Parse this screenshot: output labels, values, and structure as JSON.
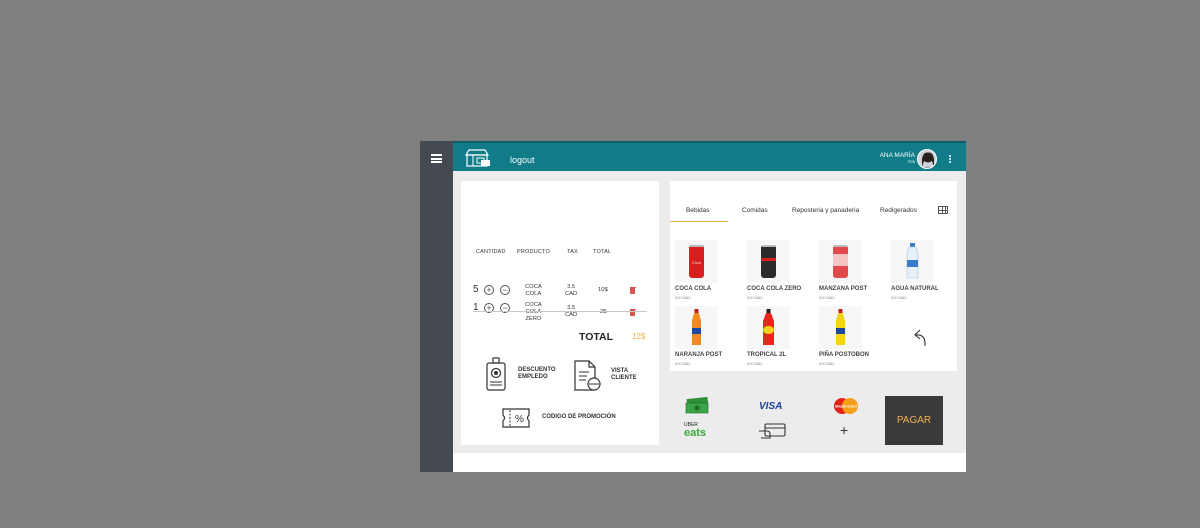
{
  "topbar": {
    "logout_label": "logout",
    "user_name": "ANA MARÍA",
    "user_role": "POS"
  },
  "order": {
    "headers": [
      "CANTIDAD",
      "PRODUCTO",
      "TAX",
      "TOTAL"
    ],
    "rows": [
      {
        "qty": "5",
        "product": "COCA\nCOLA",
        "tax": "3.5\nCAD",
        "total": "10$"
      },
      {
        "qty": "1",
        "product": "COCA\nCOLA\nZERO",
        "tax": "3.5\nCAD",
        "total": "2$"
      }
    ],
    "total_label": "TOTAL",
    "total_value": "12$",
    "actions": {
      "discount": "DESCUENTO\nEMPLEDO",
      "customer_view": "VISTA\nCLIENTE",
      "promo": "CODIGO DE PROMOCIÓN"
    }
  },
  "catalog": {
    "tabs": [
      "Bebidas",
      "Comidas",
      "Reposteria y panaderia",
      "Redigerados"
    ],
    "active_tab": "Bebidas",
    "products": [
      {
        "name": "COCA COLA",
        "price": "3.5 CAD",
        "color": "#d81e1e"
      },
      {
        "name": "COCA COLA ZERO",
        "price": "3.5 CAD",
        "color": "#2b2b2b"
      },
      {
        "name": "MANZANA POST",
        "price": "3.5 CAD",
        "color": "#e04a4a"
      },
      {
        "name": "AGUA NATURAL",
        "price": "3.5 CAD",
        "color": "#cfe3f3"
      },
      {
        "name": "NARANJA POST",
        "price": "3.5 CAD",
        "color": "#f08a20"
      },
      {
        "name": "TROPICAL 2L",
        "price": "3.5 CAD",
        "color": "#e8261e"
      },
      {
        "name": "PIÑA POSTOBON",
        "price": "3.5 CAD",
        "color": "#f2d21a"
      }
    ]
  },
  "payment": {
    "visa": "VISA",
    "uber_top": "UBER",
    "uber_eats": "eats",
    "mastercard": "MasterCard",
    "plus": "+",
    "pay_label": "PAGAR"
  },
  "colors": {
    "topbar": "#0f7c87",
    "sidebar": "#444952",
    "accent": "#f0b050",
    "pay_button": "#3a3a3a"
  }
}
